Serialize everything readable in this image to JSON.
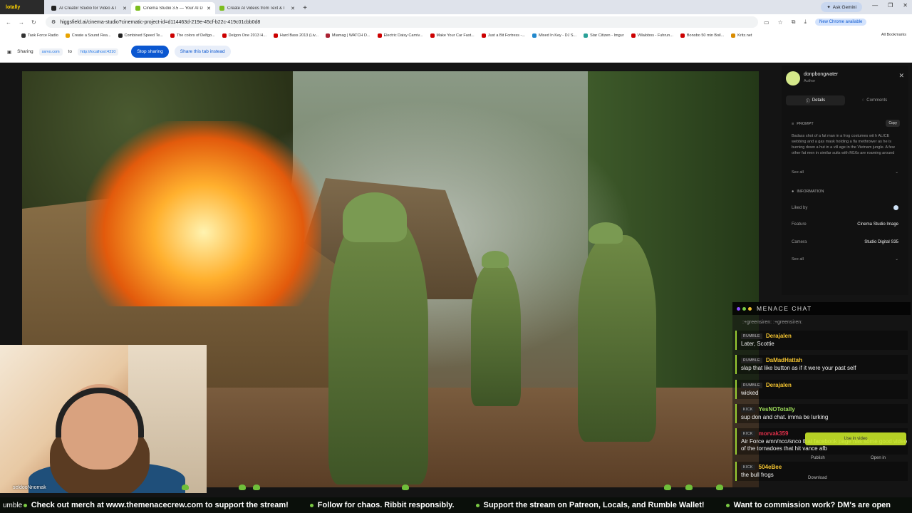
{
  "browser": {
    "first_tab_label": "lotally",
    "tabs": [
      {
        "label": "AI Creator Studio for Video & I",
        "color": "#222222"
      },
      {
        "label": "Cinema Studio 3.5 — Your AI D",
        "color": "#7cbd1e"
      },
      {
        "label": "Create AI Videos from Text & I",
        "color": "#7cbd1e"
      }
    ],
    "new_tab": "+",
    "ask_gemini": "Ask Gemini",
    "url": "higgsfield.ai/cinema-studio?cinematic-project-id=d114463d-219e-45cf-b22c-419c01cbb0d8",
    "new_chrome": "New Chrome available",
    "bookmarks": [
      {
        "label": "Task Force Radio",
        "color": "#333333"
      },
      {
        "label": "Create a Sound Rea...",
        "color": "#e8a300"
      },
      {
        "label": "Combined Speed Te...",
        "color": "#222222"
      },
      {
        "label": "The colors of Delfgo...",
        "color": "#cc0000"
      },
      {
        "label": "Delgon One 2013 H...",
        "color": "#cc0000"
      },
      {
        "label": "Hard Bass 2013 (Liv...",
        "color": "#cc0000"
      },
      {
        "label": "Miamag | WATCH D...",
        "color": "#aa2233"
      },
      {
        "label": "Electric Daisy Carniv...",
        "color": "#cc0000"
      },
      {
        "label": "Make Your Car Fast...",
        "color": "#cc0000"
      },
      {
        "label": "Just a Bit Fortress -...",
        "color": "#cc0000"
      },
      {
        "label": "Mixed In Key - DJ S...",
        "color": "#2288cc"
      },
      {
        "label": "Star Citizen - Imgur",
        "color": "#2aa198"
      },
      {
        "label": "Villalobos - Fuhrun...",
        "color": "#cc0000"
      },
      {
        "label": "Bonobo 50 min Boil...",
        "color": "#cc0000"
      },
      {
        "label": "Kritz.net",
        "color": "#d98c00"
      }
    ],
    "all_bookmarks": "All Bookmarks"
  },
  "sharebar": {
    "sharing_label": "Sharing",
    "source": "ssrvo.com",
    "to_label": "to",
    "target": "http://localhost:4310",
    "stop_sharing": "Stop sharing",
    "share_this_tab": "Share this tab instead"
  },
  "panel": {
    "username": "donpbongwater",
    "role": "Author",
    "tab_details": "Details",
    "tab_comments": "Comments",
    "prompt_heading": "PROMPT",
    "copy_label": "Copy",
    "prompt_text": "Badass shot of a fat man in a frog costumes wit h ALICE webbing and a gas mask holding a fla methrower as he is burning down a hut in a vill age in the Vietnam jungle. A few other fat men in similar suits with M16s are roaming around",
    "see_all_1": "See all",
    "information_heading": "INFORMATION",
    "liked_by_label": "Liked by",
    "feature_label": "Feature",
    "feature_value": "Cinema Studio Image",
    "camera_label": "Camera",
    "camera_value": "Studio Digital S35",
    "see_all_2": "See all"
  },
  "chat": {
    "title": "MENACE CHAT",
    "system_line": ":+greensiren: :+greensiren:",
    "messages": [
      {
        "platform": "RUMBLE",
        "user": "Derajalen",
        "user_color": "#f2c230",
        "text": "Later, Scottie"
      },
      {
        "platform": "RUMBLE",
        "user": "DaMadHattah",
        "user_color": "#f2c230",
        "text": "slap that like button as if it were your past self"
      },
      {
        "platform": "RUMBLE",
        "user": "Derajalen",
        "user_color": "#f2c230",
        "text": "wicked"
      },
      {
        "platform": "KICK",
        "user": "YesNOTotally",
        "user_color": "#9fe05a",
        "text": "sup don and chat. imma be lurking"
      },
      {
        "platform": "KICK",
        "user": "morvak359",
        "user_color": "#e0304a",
        "text": "Air Force amn/nco/snco that facebook page has some good video of the tornadoes that hit vance afb"
      },
      {
        "platform": "KICK",
        "user": "504eBee",
        "user_color": "#f2c230",
        "text": "the bull frogs"
      }
    ],
    "overlay_use_in_video": "Use in video",
    "overlay_publish": "Publish",
    "overlay_open_in": "Open in",
    "overlay_download": "Download"
  },
  "webcam": {
    "name": "seldooNnomak"
  },
  "ticker": {
    "lead": "umble",
    "items": [
      "Check out merch at www.themenacecrew.com to support the stream!",
      "Follow for chaos. Ribbit responsibly.",
      "Support the stream on Patreon, Locals, and Rumble Wallet!",
      "Want to commission work? DM's are open"
    ]
  }
}
